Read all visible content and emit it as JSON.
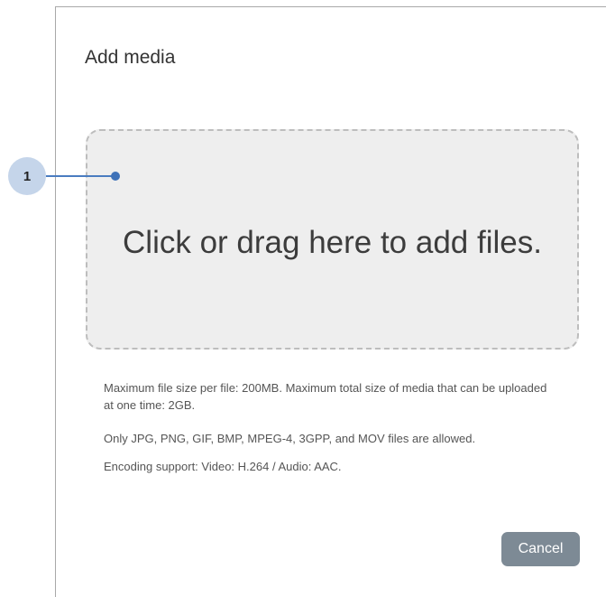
{
  "dialog": {
    "title": "Add media",
    "dropzone_text": "Click or drag here to add files.",
    "info_size": "Maximum file size per file: 200MB. Maximum total size of media that can be uploaded at one time: 2GB.",
    "info_types": "Only JPG, PNG, GIF, BMP, MPEG-4, 3GPP, and MOV files are allowed.",
    "info_encoding": "Encoding support: Video: H.264 / Audio: AAC.",
    "cancel_label": "Cancel"
  },
  "annotation": {
    "label": "1",
    "color": "#3f72b8"
  }
}
